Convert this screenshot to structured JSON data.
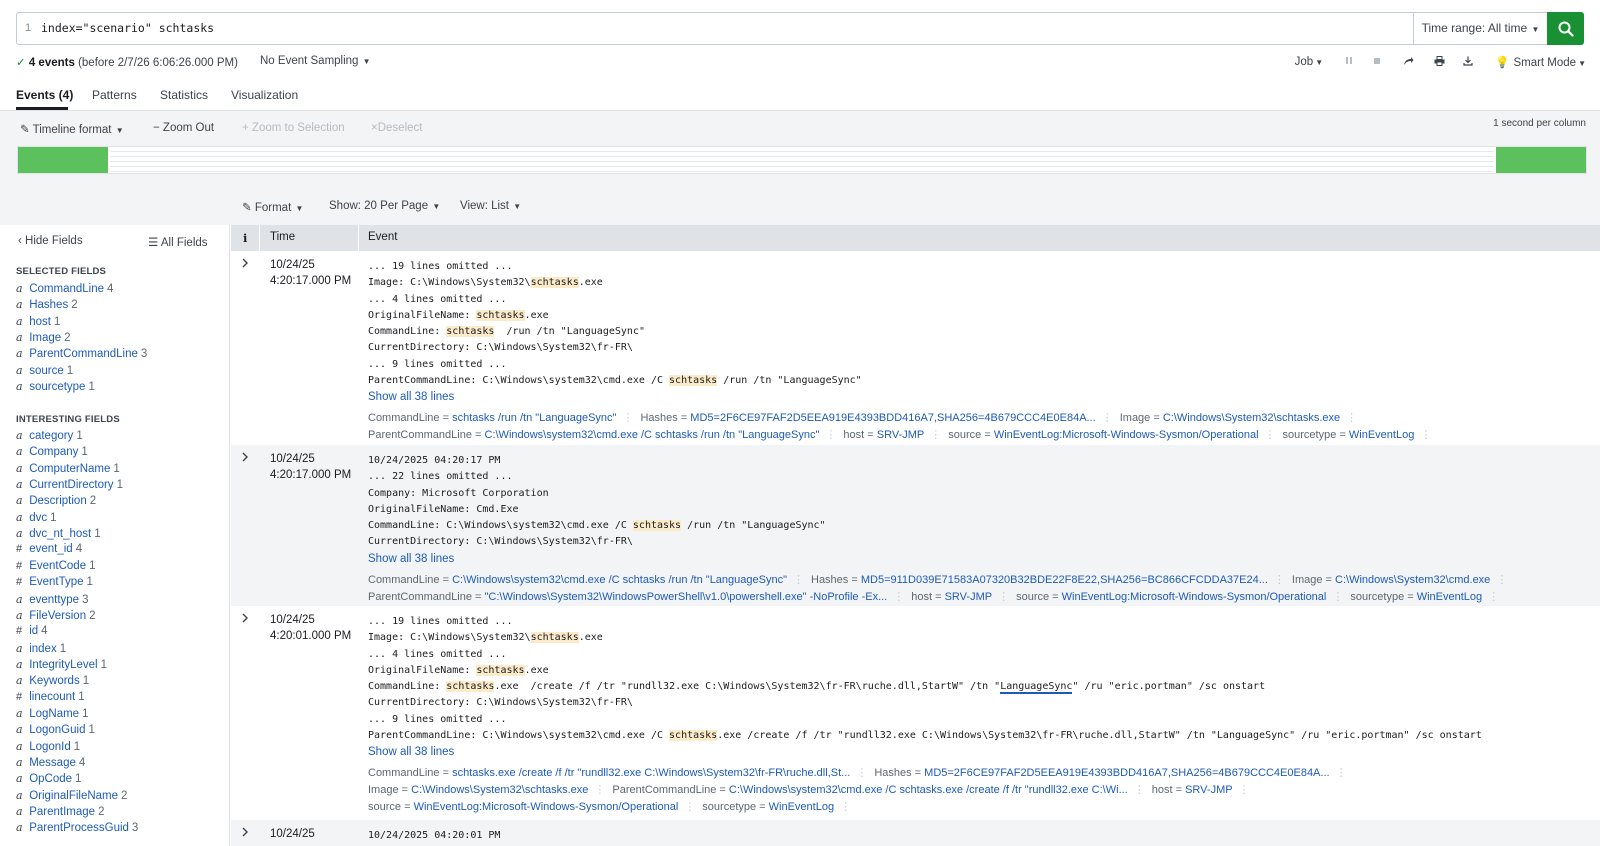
{
  "search": {
    "line_number": "1",
    "query": "index=\"scenario\" schtasks",
    "time_range": "Time range: All time",
    "go_icon": "search-icon"
  },
  "status": {
    "check_icon": "✓",
    "count": "4 events",
    "before": "(before 2/7/26 6:06:26.000 PM)",
    "sampling": "No Event Sampling",
    "job": "Job",
    "mode": "Smart Mode"
  },
  "tabs": [
    {
      "label": "Events (4)",
      "active": true
    },
    {
      "label": "Patterns"
    },
    {
      "label": "Statistics"
    },
    {
      "label": "Visualization"
    }
  ],
  "timeline": {
    "format": "Timeline format",
    "zoom_out": "Zoom Out",
    "zoom_selection": "Zoom to Selection",
    "deselect": "Deselect",
    "per_column": "1 second per column"
  },
  "results_controls": {
    "format": "Format",
    "show": "Show: 20 Per Page",
    "view": "View: List"
  },
  "sidebar": {
    "hide_fields": "Hide Fields",
    "all_fields": "All Fields",
    "selected_heading": "SELECTED FIELDS",
    "interesting_heading": "INTERESTING FIELDS",
    "selected": [
      {
        "type": "a",
        "name": "CommandLine",
        "count": "4"
      },
      {
        "type": "a",
        "name": "Hashes",
        "count": "2"
      },
      {
        "type": "a",
        "name": "host",
        "count": "1"
      },
      {
        "type": "a",
        "name": "Image",
        "count": "2"
      },
      {
        "type": "a",
        "name": "ParentCommandLine",
        "count": "3"
      },
      {
        "type": "a",
        "name": "source",
        "count": "1"
      },
      {
        "type": "a",
        "name": "sourcetype",
        "count": "1"
      }
    ],
    "interesting": [
      {
        "type": "a",
        "name": "category",
        "count": "1"
      },
      {
        "type": "a",
        "name": "Company",
        "count": "1"
      },
      {
        "type": "a",
        "name": "ComputerName",
        "count": "1"
      },
      {
        "type": "a",
        "name": "CurrentDirectory",
        "count": "1"
      },
      {
        "type": "a",
        "name": "Description",
        "count": "2"
      },
      {
        "type": "a",
        "name": "dvc",
        "count": "1"
      },
      {
        "type": "a",
        "name": "dvc_nt_host",
        "count": "1"
      },
      {
        "type": "#",
        "name": "event_id",
        "count": "4"
      },
      {
        "type": "#",
        "name": "EventCode",
        "count": "1"
      },
      {
        "type": "#",
        "name": "EventType",
        "count": "1"
      },
      {
        "type": "a",
        "name": "eventtype",
        "count": "3"
      },
      {
        "type": "a",
        "name": "FileVersion",
        "count": "2"
      },
      {
        "type": "#",
        "name": "id",
        "count": "4"
      },
      {
        "type": "a",
        "name": "index",
        "count": "1"
      },
      {
        "type": "a",
        "name": "IntegrityLevel",
        "count": "1"
      },
      {
        "type": "a",
        "name": "Keywords",
        "count": "1"
      },
      {
        "type": "#",
        "name": "linecount",
        "count": "1"
      },
      {
        "type": "a",
        "name": "LogName",
        "count": "1"
      },
      {
        "type": "a",
        "name": "LogonGuid",
        "count": "1"
      },
      {
        "type": "a",
        "name": "LogonId",
        "count": "1"
      },
      {
        "type": "a",
        "name": "Message",
        "count": "4"
      },
      {
        "type": "a",
        "name": "OpCode",
        "count": "1"
      },
      {
        "type": "a",
        "name": "OriginalFileName",
        "count": "2"
      },
      {
        "type": "a",
        "name": "ParentImage",
        "count": "2"
      },
      {
        "type": "a",
        "name": "ParentProcessGuid",
        "count": "3"
      }
    ]
  },
  "table": {
    "info_header": "i",
    "time_header": "Time",
    "event_header": "Event"
  },
  "events": [
    {
      "date": "10/24/25",
      "time": "4:20:17.000 PM",
      "lines": [
        [
          "... 19 lines omitted ..."
        ],
        [
          "Image: C:\\Windows\\System32\\",
          {
            "h": "schtasks"
          },
          ".exe"
        ],
        [
          "... 4 lines omitted ..."
        ],
        [
          "OriginalFileName: ",
          {
            "h": "schtasks"
          },
          ".exe"
        ],
        [
          "CommandLine: ",
          {
            "h": "schtasks"
          },
          "  /run /tn \"LanguageSync\""
        ],
        [
          "CurrentDirectory: C:\\Windows\\System32\\fr-FR\\"
        ],
        [
          "... 9 lines omitted ..."
        ],
        [
          "ParentCommandLine: C:\\Windows\\system32\\cmd.exe /C ",
          {
            "h": "schtasks"
          },
          " /run /tn \"LanguageSync\""
        ]
      ],
      "show_all": "Show all 38 lines",
      "fields": [
        [
          [
            "CommandLine",
            "schtasks /run /tn \"LanguageSync\""
          ],
          [
            "Hashes",
            "MD5=2F6CE97FAF2D5EEA919E4393BDD416A7,SHA256=4B679CCC4E0E84A..."
          ],
          [
            "Image",
            "C:\\Windows\\System32\\schtasks.exe"
          ]
        ],
        [
          [
            "ParentCommandLine",
            "C:\\Windows\\system32\\cmd.exe /C schtasks /run /tn \"LanguageSync\""
          ],
          [
            "host",
            "SRV-JMP"
          ],
          [
            "source",
            "WinEventLog:Microsoft-Windows-Sysmon/Operational"
          ],
          [
            "sourcetype",
            "WinEventLog"
          ]
        ]
      ]
    },
    {
      "date": "10/24/25",
      "time": "4:20:17.000 PM",
      "lines": [
        [
          "10/24/2025 04:20:17 PM"
        ],
        [
          "... 22 lines omitted ..."
        ],
        [
          "Company: Microsoft Corporation"
        ],
        [
          "OriginalFileName: Cmd.Exe"
        ],
        [
          "CommandLine: C:\\Windows\\system32\\cmd.exe /C ",
          {
            "h": "schtasks"
          },
          " /run /tn \"LanguageSync\""
        ],
        [
          "CurrentDirectory: C:\\Windows\\System32\\fr-FR\\"
        ]
      ],
      "show_all": "Show all 38 lines",
      "fields": [
        [
          [
            "CommandLine",
            "C:\\Windows\\system32\\cmd.exe /C schtasks /run /tn \"LanguageSync\""
          ],
          [
            "Hashes",
            "MD5=911D039E71583A07320B32BDE22F8E22,SHA256=BC866CFCDDA37E24..."
          ],
          [
            "Image",
            "C:\\Windows\\System32\\cmd.exe"
          ]
        ],
        [
          [
            "ParentCommandLine",
            "\"C:\\Windows\\System32\\WindowsPowerShell\\v1.0\\powershell.exe\" -NoProfile -Ex..."
          ],
          [
            "host",
            "SRV-JMP"
          ],
          [
            "source",
            "WinEventLog:Microsoft-Windows-Sysmon/Operational"
          ],
          [
            "sourcetype",
            "WinEventLog"
          ]
        ]
      ]
    },
    {
      "date": "10/24/25",
      "time": "4:20:01.000 PM",
      "lines": [
        [
          "... 19 lines omitted ..."
        ],
        [
          "Image: C:\\Windows\\System32\\",
          {
            "h": "schtasks"
          },
          ".exe"
        ],
        [
          "... 4 lines omitted ..."
        ],
        [
          "OriginalFileName: ",
          {
            "h": "schtasks"
          },
          ".exe"
        ],
        [
          "CommandLine: ",
          {
            "h": "schtasks"
          },
          ".exe  /create /f /tr \"rundll32.exe C:\\Windows\\System32\\fr-FR\\ruche.dll,StartW\" /tn \"",
          {
            "u": "LanguageSync"
          },
          "\" /ru \"eric.portman\" /sc onstart"
        ],
        [
          "CurrentDirectory: C:\\Windows\\System32\\fr-FR\\"
        ],
        [
          "... 9 lines omitted ..."
        ],
        [
          "ParentCommandLine: C:\\Windows\\system32\\cmd.exe /C ",
          {
            "h": "schtasks"
          },
          ".exe /create /f /tr \"rundll32.exe C:\\Windows\\System32\\fr-FR\\ruche.dll,StartW\" /tn \"LanguageSync\" /ru \"eric.portman\" /sc onstart"
        ]
      ],
      "show_all": "Show all 38 lines",
      "fields": [
        [
          [
            "CommandLine",
            "schtasks.exe /create /f /tr \"rundll32.exe C:\\Windows\\System32\\fr-FR\\ruche.dll,St..."
          ],
          [
            "Hashes",
            "MD5=2F6CE97FAF2D5EEA919E4393BDD416A7,SHA256=4B679CCC4E0E84A..."
          ]
        ],
        [
          [
            "Image",
            "C:\\Windows\\System32\\schtasks.exe"
          ],
          [
            "ParentCommandLine",
            "C:\\Windows\\system32\\cmd.exe /C schtasks.exe /create /f /tr \"rundll32.exe C:\\Wi..."
          ],
          [
            "host",
            "SRV-JMP"
          ]
        ],
        [
          [
            "source",
            "WinEventLog:Microsoft-Windows-Sysmon/Operational"
          ],
          [
            "sourcetype",
            "WinEventLog"
          ]
        ]
      ]
    },
    {
      "date": "10/24/25",
      "time": "",
      "lines": [
        [
          "10/24/2025 04:20:01 PM"
        ]
      ],
      "show_all": "",
      "fields": []
    }
  ],
  "colors": {
    "accent_green": "#1a9035",
    "timeline_bar": "#5cc05c",
    "link_blue": "#1e5bb8",
    "highlight": "#fcebc9"
  }
}
